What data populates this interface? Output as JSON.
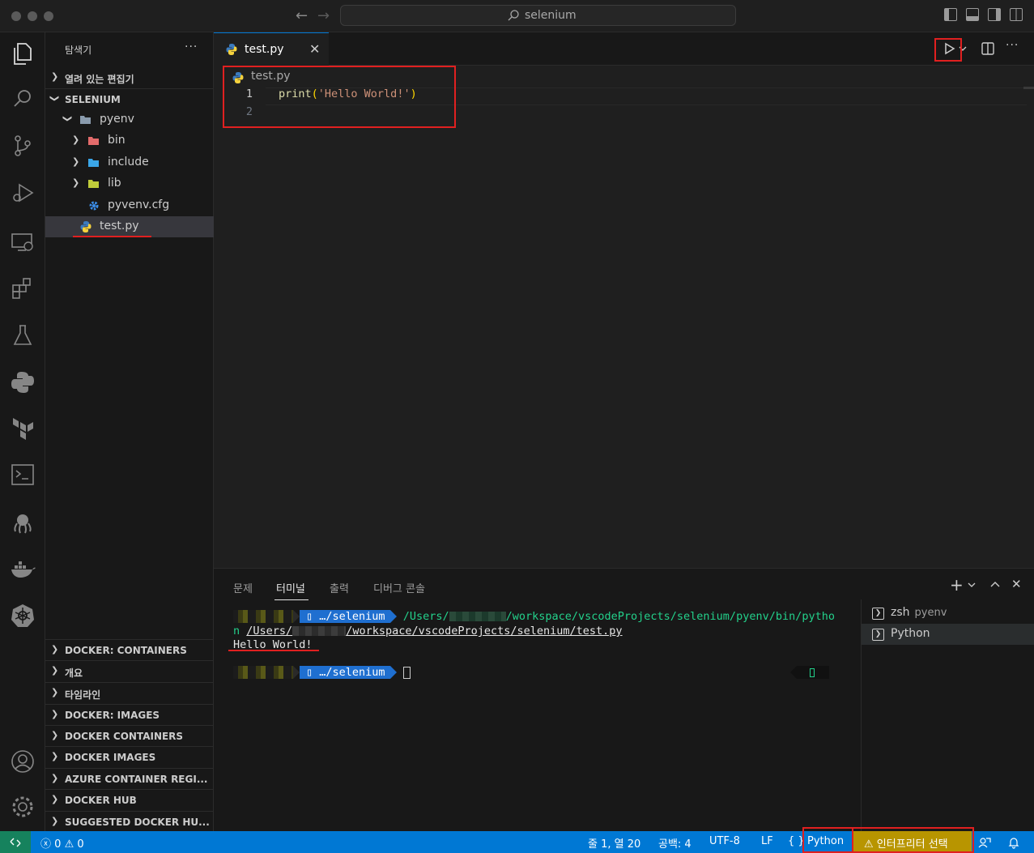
{
  "window": {
    "search_text": "selenium"
  },
  "sidebar": {
    "title": "탐색기",
    "more": "···",
    "open_editors": "열려 있는 편집기",
    "workspace": "SELENIUM",
    "tree": [
      {
        "label": "pyenv"
      },
      {
        "label": "bin"
      },
      {
        "label": "include"
      },
      {
        "label": "lib"
      },
      {
        "label": "pyvenv.cfg"
      },
      {
        "label": "test.py"
      }
    ],
    "sections": [
      "DOCKER: CONTAINERS",
      "개요",
      "타임라인",
      "DOCKER: IMAGES",
      "DOCKER CONTAINERS",
      "DOCKER IMAGES",
      "AZURE CONTAINER REGI...",
      "DOCKER HUB",
      "SUGGESTED DOCKER HU..."
    ]
  },
  "editor": {
    "tab_label": "test.py",
    "tab_close": "✕",
    "breadcrumb": "test.py",
    "lines": [
      {
        "num": "1",
        "fn": "print",
        "open": "(",
        "str": "'Hello World!'",
        "close": ")"
      },
      {
        "num": "2"
      }
    ]
  },
  "panel": {
    "tabs": [
      "문제",
      "터미널",
      "출력",
      "디버그 콘솔"
    ],
    "terminal": {
      "prompt_dir": "…/selenium",
      "cmd_part1": "/Users/",
      "cmd_part2": "/workspace/vscodeProjects/selenium/pyenv/bin/pytho",
      "cmd_wrap_n": "n",
      "arg_part1": "/Users/",
      "arg_part2": "/workspace/vscodeProjects/selenium/test.py",
      "output": "Hello World!"
    },
    "terminals": [
      {
        "name": "zsh",
        "sub": "pyenv"
      },
      {
        "name": "Python",
        "sub": ""
      }
    ]
  },
  "statusbar": {
    "errors": "0",
    "warnings": "0",
    "position": "줄 1, 열 20",
    "spaces": "공백: 4",
    "encoding": "UTF-8",
    "eol": "LF",
    "language_braces": "{ }",
    "language": "Python",
    "interpreter": "⚠ 인터프리터 선택"
  },
  "colors": {
    "accent": "#0078d4",
    "remote": "#16825d",
    "warning": "#b89500",
    "annotation": "#e02020"
  }
}
